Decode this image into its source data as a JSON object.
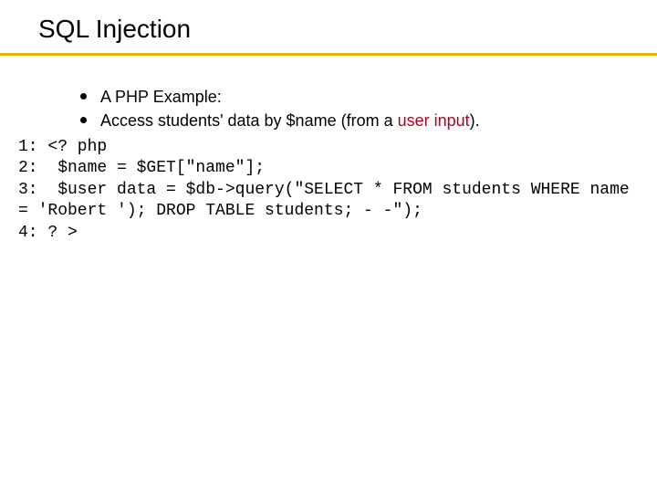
{
  "title": "SQL Injection",
  "bullets": [
    {
      "text": "A PHP Example:"
    },
    {
      "prefix": "Access students' data by $name (from a ",
      "highlight": "user input",
      "suffix": ")."
    }
  ],
  "code": {
    "l1": "1: <? php",
    "l2": "2:  $name = $GET[\"name\"];",
    "l3": "3:  $user data = $db->query(\"SELECT * FROM students WHERE name = 'Robert '); DROP TABLE students; - -\");",
    "l4": "4: ? >"
  }
}
